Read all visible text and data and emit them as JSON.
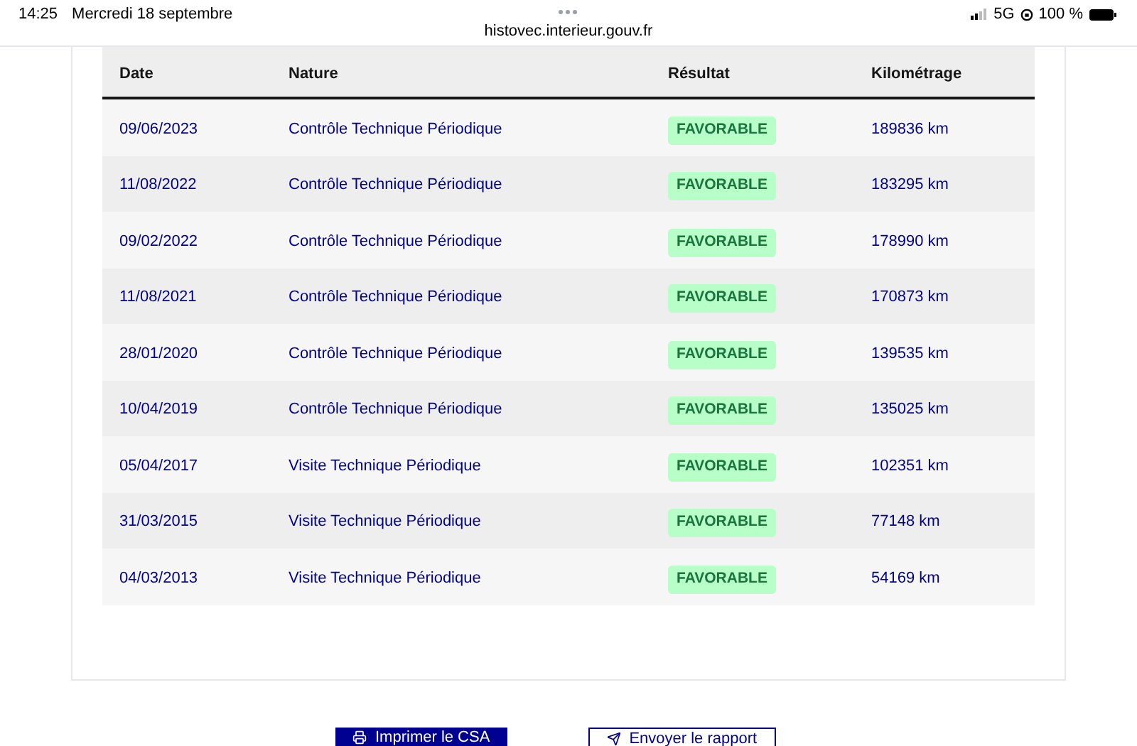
{
  "status_bar": {
    "time": "14:25",
    "date": "Mercredi 18 septembre",
    "network": "5G",
    "battery": "100 %"
  },
  "address_bar": {
    "url": "histovec.interieur.gouv.fr"
  },
  "table": {
    "columns": [
      "Date",
      "Nature",
      "Résultat",
      "Kilométrage"
    ],
    "rows": [
      {
        "date": "09/06/2023",
        "nature": "Contrôle Technique Périodique",
        "result": "FAVORABLE",
        "mileage": "189836 km"
      },
      {
        "date": "11/08/2022",
        "nature": "Contrôle Technique Périodique",
        "result": "FAVORABLE",
        "mileage": "183295 km"
      },
      {
        "date": "09/02/2022",
        "nature": "Contrôle Technique Périodique",
        "result": "FAVORABLE",
        "mileage": "178990 km"
      },
      {
        "date": "11/08/2021",
        "nature": "Contrôle Technique Périodique",
        "result": "FAVORABLE",
        "mileage": "170873 km"
      },
      {
        "date": "28/01/2020",
        "nature": "Contrôle Technique Périodique",
        "result": "FAVORABLE",
        "mileage": "139535 km"
      },
      {
        "date": "10/04/2019",
        "nature": "Contrôle Technique Périodique",
        "result": "FAVORABLE",
        "mileage": "135025 km"
      },
      {
        "date": "05/04/2017",
        "nature": "Visite Technique Périodique",
        "result": "FAVORABLE",
        "mileage": "102351 km"
      },
      {
        "date": "31/03/2015",
        "nature": "Visite Technique Périodique",
        "result": "FAVORABLE",
        "mileage": "77148 km"
      },
      {
        "date": "04/03/2013",
        "nature": "Visite Technique Périodique",
        "result": "FAVORABLE",
        "mileage": "54169 km"
      }
    ]
  },
  "buttons": [
    {
      "label": "Imprimer le CSA",
      "kind": "primary"
    },
    {
      "label": "Envoyer le rapport",
      "kind": "secondary"
    }
  ]
}
